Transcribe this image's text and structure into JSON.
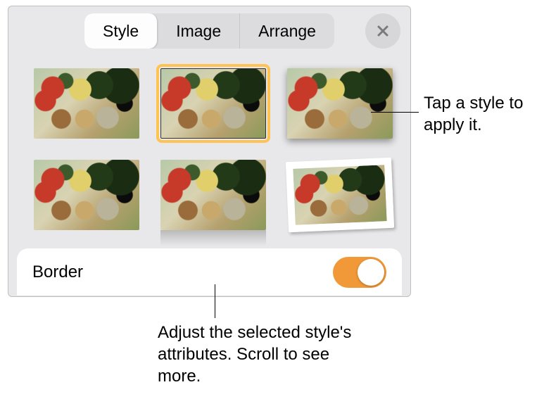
{
  "tabs": {
    "style": "Style",
    "image": "Image",
    "arrange": "Arrange"
  },
  "border": {
    "label": "Border",
    "on": true
  },
  "callouts": {
    "apply": "Tap a style to apply it.",
    "adjust": "Adjust the selected style's attributes. Scroll to see more."
  }
}
